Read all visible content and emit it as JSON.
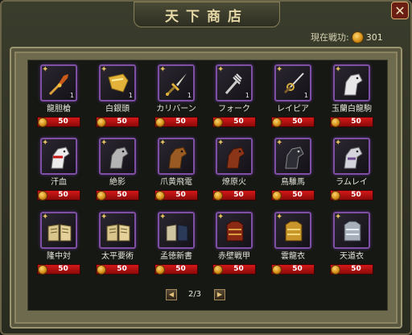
{
  "title": "天下商店",
  "close_label": "✕",
  "merit": {
    "label": "現在戦功:",
    "value": "301"
  },
  "items": [
    {
      "name": "龍胆槍",
      "price": "50",
      "qty": "1",
      "icon": "spear-icon"
    },
    {
      "name": "白銀頭",
      "price": "50",
      "qty": "1",
      "icon": "golden-armor-piece-icon"
    },
    {
      "name": "カリバーン",
      "price": "50",
      "qty": "1",
      "icon": "sword-icon"
    },
    {
      "name": "フォーク",
      "price": "50",
      "qty": "1",
      "icon": "fork-icon"
    },
    {
      "name": "レイピア",
      "price": "50",
      "qty": "1",
      "icon": "rapier-icon"
    },
    {
      "name": "玉蘭白龍駒",
      "price": "50",
      "qty": "",
      "icon": "white-horse-icon"
    },
    {
      "name": "汗血",
      "price": "50",
      "qty": "",
      "icon": "white-horse-red-icon"
    },
    {
      "name": "絶影",
      "price": "50",
      "qty": "",
      "icon": "grey-horse-icon"
    },
    {
      "name": "爪黄飛電",
      "price": "50",
      "qty": "",
      "icon": "brown-horse-icon"
    },
    {
      "name": "燎原火",
      "price": "50",
      "qty": "",
      "icon": "red-horse-icon"
    },
    {
      "name": "鳥騅馬",
      "price": "50",
      "qty": "",
      "icon": "black-horse-icon"
    },
    {
      "name": "ラムレイ",
      "price": "50",
      "qty": "",
      "icon": "silver-horse-icon"
    },
    {
      "name": "隆中対",
      "price": "50",
      "qty": "",
      "icon": "open-book-icon"
    },
    {
      "name": "太平要術",
      "price": "50",
      "qty": "",
      "icon": "open-book-icon"
    },
    {
      "name": "孟徳新書",
      "price": "50",
      "qty": "",
      "icon": "dark-book-icon"
    },
    {
      "name": "赤壁戦甲",
      "price": "50",
      "qty": "",
      "icon": "red-armor-icon"
    },
    {
      "name": "雲龍衣",
      "price": "50",
      "qty": "",
      "icon": "gold-armor-icon"
    },
    {
      "name": "天道衣",
      "price": "50",
      "qty": "",
      "icon": "silver-armor-icon"
    }
  ],
  "pagination": {
    "prev": "◀",
    "next": "▶",
    "page": "2/3"
  },
  "colors": {
    "slot_border": "#7e4fa4",
    "buy_button": "#c41414",
    "coin": "#e3a21a",
    "title": "#e6d8a6"
  }
}
